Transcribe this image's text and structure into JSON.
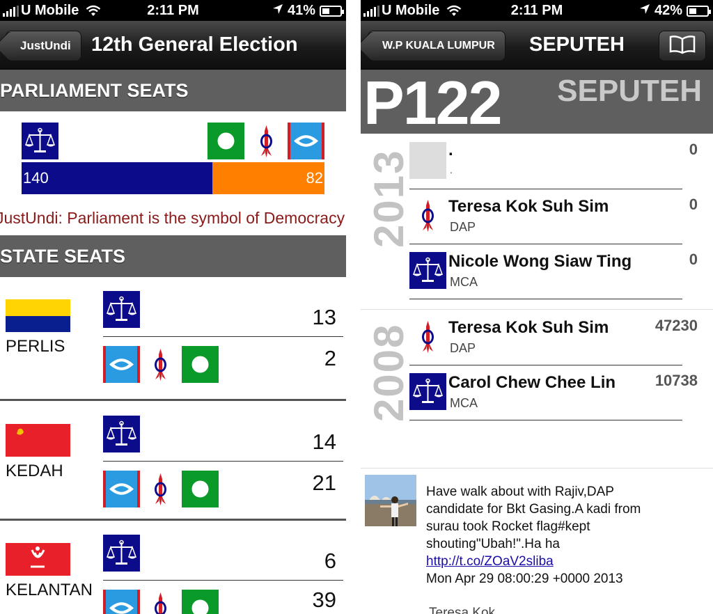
{
  "left": {
    "status": {
      "carrier": "U Mobile",
      "time": "2:11 PM",
      "battery": "41%",
      "battery_level": 0.41
    },
    "nav": {
      "back_label": "JustUndi",
      "title": "12th General Election"
    },
    "parliament": {
      "header": "PARLIAMENT SEATS",
      "bn_seats": "140",
      "pr_seats": "82",
      "bn_fraction": 0.6306
    },
    "ticker": "JustUndi: Parliament is the symbol of  Democracy",
    "state_header": "STATE SEATS",
    "states": [
      {
        "name": "PERLIS",
        "flag": "perlis-flag",
        "bn": "13",
        "pr": "2"
      },
      {
        "name": "KEDAH",
        "flag": "kedah-flag",
        "bn": "14",
        "pr": "21"
      },
      {
        "name": "KELANTAN",
        "flag": "kelantan-flag",
        "bn": "6",
        "pr": "39"
      }
    ]
  },
  "right": {
    "status": {
      "carrier": "U Mobile",
      "time": "2:11 PM",
      "battery": "42%",
      "battery_level": 0.42
    },
    "nav": {
      "back_label": "W.P KUALA LUMPUR",
      "title": "SEPUTEH"
    },
    "seat_code": "P122",
    "seat_name": "SEPUTEH",
    "elections": [
      {
        "year": "2013",
        "candidates": [
          {
            "name": ".",
            "party": ".",
            "votes": "0",
            "logo": "placeholder"
          },
          {
            "name": "Teresa Kok Suh Sim",
            "party": "DAP",
            "votes": "0",
            "logo": "dap-rocket-icon"
          },
          {
            "name": "Nicole Wong Siaw Ting",
            "party": "MCA",
            "votes": "0",
            "logo": "bn-scales-icon"
          }
        ]
      },
      {
        "year": "2008",
        "candidates": [
          {
            "name": "Teresa Kok Suh Sim",
            "party": "DAP",
            "votes": "47230",
            "logo": "dap-rocket-icon"
          },
          {
            "name": "Carol Chew Chee Lin",
            "party": "MCA",
            "votes": "10738",
            "logo": "bn-scales-icon"
          }
        ]
      }
    ],
    "tweet": {
      "lines": [
        "Have walk about with Rajiv,DAP",
        "candidate for Bkt Gasing.A kadi from",
        "surau took Rocket flag#kept",
        "shouting\"Ubah!\".Ha ha"
      ],
      "link": "http://t.co/ZOaV2sliba",
      "date": "Mon Apr 29 08:00:29 +0000 2013",
      "author": "Teresa Kok"
    }
  },
  "colors": {
    "bn_blue": "#0c0c8a",
    "pr_orange": "#ff8000",
    "pas_green": "#0a9a2a",
    "pkr_cyan": "#2a9be0",
    "dap_red": "#d21f26"
  }
}
